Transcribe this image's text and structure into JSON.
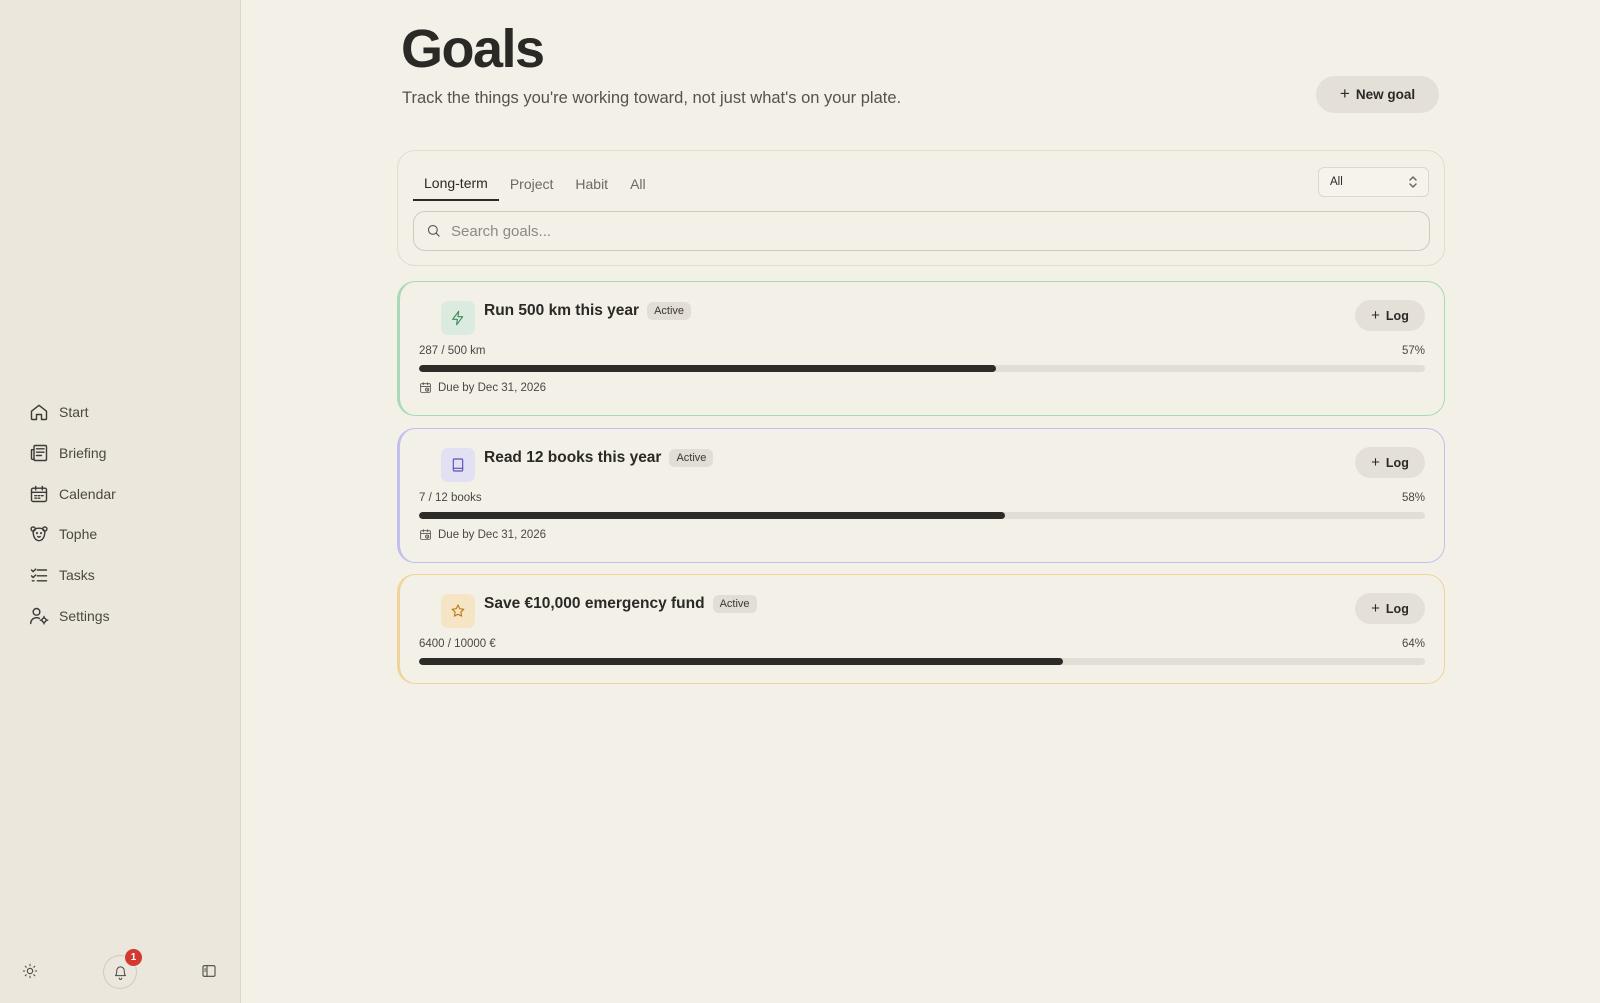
{
  "sidebar": {
    "items": [
      {
        "label": "Start",
        "icon": "home-icon"
      },
      {
        "label": "Briefing",
        "icon": "newspaper-icon"
      },
      {
        "label": "Calendar",
        "icon": "calendar-icon"
      },
      {
        "label": "Tophe",
        "icon": "bear-icon"
      },
      {
        "label": "Tasks",
        "icon": "list-checks-icon"
      },
      {
        "label": "Settings",
        "icon": "user-cog-icon"
      }
    ],
    "notification_count": "1"
  },
  "header": {
    "title": "Goals",
    "subtitle": "Track the things you're working toward, not just what's on your plate.",
    "new_goal_label": "New goal"
  },
  "filters": {
    "tabs": [
      {
        "label": "Long-term",
        "active": true
      },
      {
        "label": "Project",
        "active": false
      },
      {
        "label": "Habit",
        "active": false
      },
      {
        "label": "All",
        "active": false
      }
    ],
    "status_select": "All",
    "search_placeholder": "Search goals..."
  },
  "goals": [
    {
      "title": "Run 500 km this year",
      "status": "Active",
      "icon": "lightning-icon",
      "accent": "#a8d9b8",
      "icon_bg": "#dcebdf",
      "icon_color": "#3d8a58",
      "progress_text": "287 / 500 km",
      "percent_label": "57%",
      "progress": 0.574,
      "due": "Due by Dec 31, 2026",
      "log_label": "Log"
    },
    {
      "title": "Read 12 books this year",
      "status": "Active",
      "icon": "book-icon",
      "accent": "#c2bfee",
      "icon_bg": "#e2e0f3",
      "icon_color": "#5a52b8",
      "progress_text": "7 / 12 books",
      "percent_label": "58%",
      "progress": 0.583,
      "due": "Due by Dec 31, 2026",
      "log_label": "Log"
    },
    {
      "title": "Save €10,000 emergency fund",
      "status": "Active",
      "icon": "star-icon",
      "accent": "#f0d49a",
      "icon_bg": "#f6e5c4",
      "icon_color": "#b97a14",
      "progress_text": "6400 / 10000 €",
      "percent_label": "64%",
      "progress": 0.64,
      "due": "",
      "log_label": "Log"
    }
  ]
}
